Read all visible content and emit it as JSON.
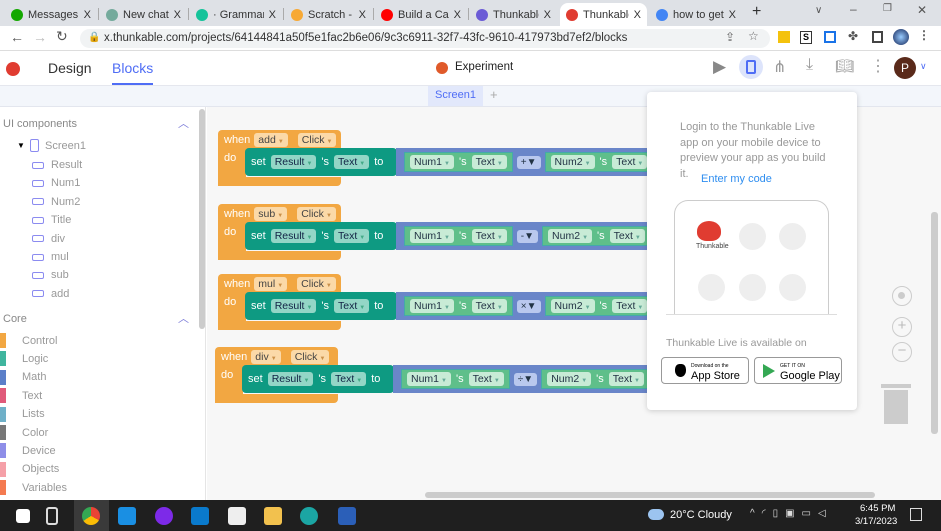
{
  "browser": {
    "tabs": [
      {
        "label": "Messages",
        "color": "#14a800"
      },
      {
        "label": "New chat",
        "color": "#74aa9c"
      },
      {
        "label": "· Grammarl",
        "color": "#15c39a"
      },
      {
        "label": "Scratch - Im",
        "color": "#f7a935"
      },
      {
        "label": "Build a Calc",
        "color": "#ff0000"
      },
      {
        "label": "Thunkable",
        "color": "#6b5bd6"
      },
      {
        "label": "Thunkable",
        "color": "#e03c31",
        "active": true
      },
      {
        "label": "how to get",
        "color": "#4285f4"
      }
    ],
    "close_glyph": "X",
    "new_tab": "+",
    "url": "x.thunkable.com/projects/64144841a50f5e1fac2b6e06/9c3c6911-32f7-43fc-9610-417973bd7ef2/blocks"
  },
  "header": {
    "design": "Design",
    "blocks": "Blocks",
    "project": "Experiment",
    "avatar": "P"
  },
  "screen_tab": {
    "label": "Screen1",
    "add": "+"
  },
  "sidebar": {
    "ui_title": "UI components",
    "screen": "Screen1",
    "components": [
      "Result",
      "Num1",
      "Num2",
      "Title",
      "div",
      "mul",
      "sub",
      "add"
    ],
    "core_title": "Core",
    "core": [
      {
        "label": "Control",
        "color": "#f2a742"
      },
      {
        "label": "Logic",
        "color": "#3fb59e"
      },
      {
        "label": "Math",
        "color": "#5b7fc9"
      },
      {
        "label": "Text",
        "color": "#e05a7a"
      },
      {
        "label": "Lists",
        "color": "#6fb0c8"
      },
      {
        "label": "Color",
        "color": "#777777"
      },
      {
        "label": "Device",
        "color": "#8e8ee8"
      },
      {
        "label": "Objects",
        "color": "#f5a0a8"
      },
      {
        "label": "Variables",
        "color": "#f47a50"
      }
    ]
  },
  "blocks": {
    "when": "when",
    "do": "do",
    "set": "set",
    "s": "'s",
    "to": "to",
    "click": "Click",
    "target": "Result",
    "prop": "Text",
    "left": "Num1",
    "right": "Num2",
    "events": [
      {
        "component": "add",
        "op": "+"
      },
      {
        "component": "sub",
        "op": "-"
      },
      {
        "component": "mul",
        "op": "×"
      },
      {
        "component": "div",
        "op": "÷"
      }
    ]
  },
  "popup": {
    "text": "Login to the Thunkable Live app on your mobile device to preview your app as you build it.",
    "link": "Enter my code",
    "app_label": "Thunkable",
    "available": "Thunkable Live is available on",
    "appstore_small": "Download on the",
    "appstore": "App Store",
    "play_small": "GET IT ON",
    "play": "Google Play"
  },
  "taskbar": {
    "weather": "20°C  Cloudy",
    "time": "6:45 PM",
    "date": "3/17/2023"
  }
}
